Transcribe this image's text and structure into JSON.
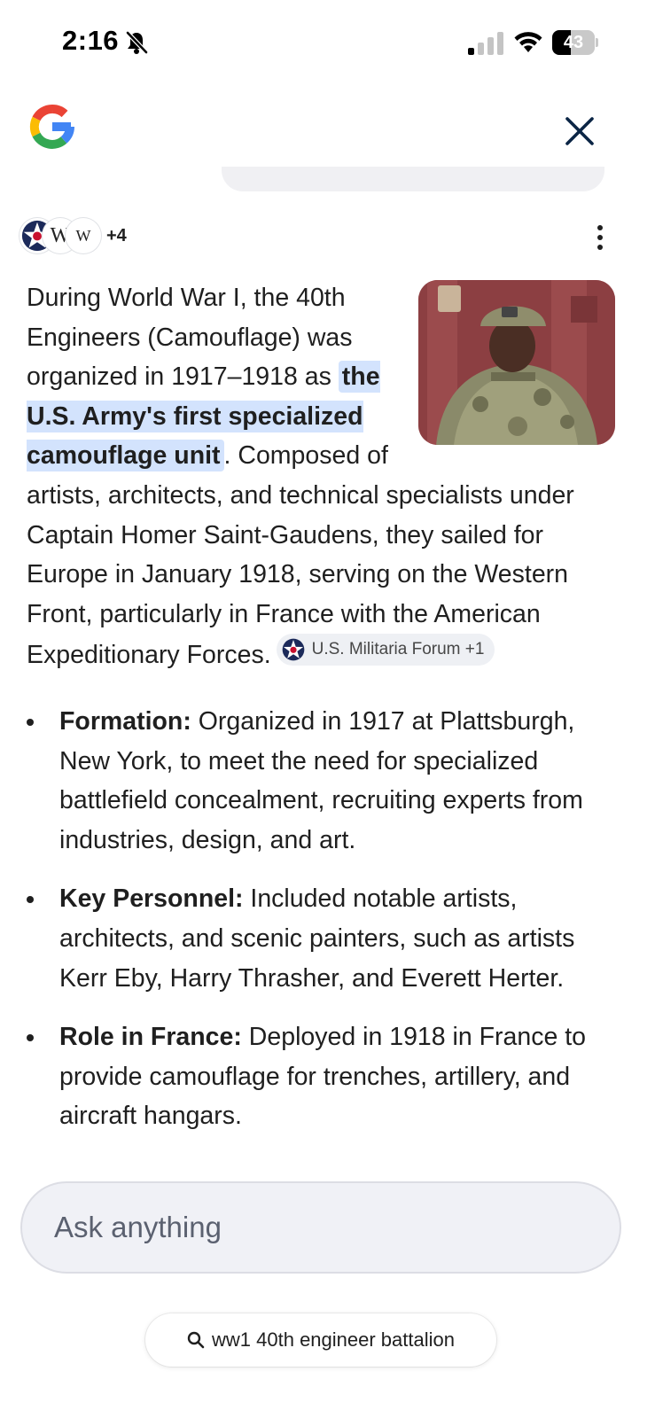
{
  "status_bar": {
    "time": "2:16",
    "battery": "43",
    "battery_level": 0.43,
    "icons": [
      "bell-slash-icon",
      "cellular-signal-icon",
      "wifi-icon",
      "battery-icon"
    ]
  },
  "header": {
    "logo": "google-g-logo",
    "close_icon": "close-icon"
  },
  "sources": {
    "icons": [
      "military-roundel-icon",
      "wikipedia-icon",
      "wikipedia-icon"
    ],
    "wiki_glyph_1": "W",
    "wiki_glyph_2": "W",
    "more_count": "+4",
    "menu_icon": "more-vert-icon"
  },
  "answer": {
    "intro_before": "During World War I, the 40th Engineers (Camouflage) was organized in 1917–1918 as ",
    "highlight": "the U.S. Army's first specialized camouflage unit",
    "intro_after": ". Composed of artists, architects, and technical specialists under Captain Homer Saint-Gaudens, they sailed for Europe in January 1918, serving on the Western Front, particularly in France with the American Expeditionary Forces.",
    "citation": "U.S. Militaria Forum +1",
    "bullets": [
      {
        "label": "Formation:",
        "text": " Organized in 1917 at Plattsburgh, New York, to meet the need for specialized battlefield concealment, recruiting experts from industries, design, and art."
      },
      {
        "label": "Key Personnel:",
        "text": " Included notable artists, architects, and scenic painters, such as artists Kerr Eby, Harry Thrasher, and Everett Herter."
      },
      {
        "label": "Role in France:",
        "text": " Deployed in 1918 in France to provide camouflage for trenches, artillery, and aircraft hangars."
      }
    ]
  },
  "colors": {
    "highlight_bg": "#d3e3fd",
    "chip_bg": "#eef0f4",
    "input_bg": "#f0f1f6",
    "close_icon": "#0b2545"
  },
  "ask": {
    "placeholder": "Ask anything"
  },
  "search_pill": {
    "label": "ww1 40th engineer battalion",
    "icon": "search-icon"
  }
}
